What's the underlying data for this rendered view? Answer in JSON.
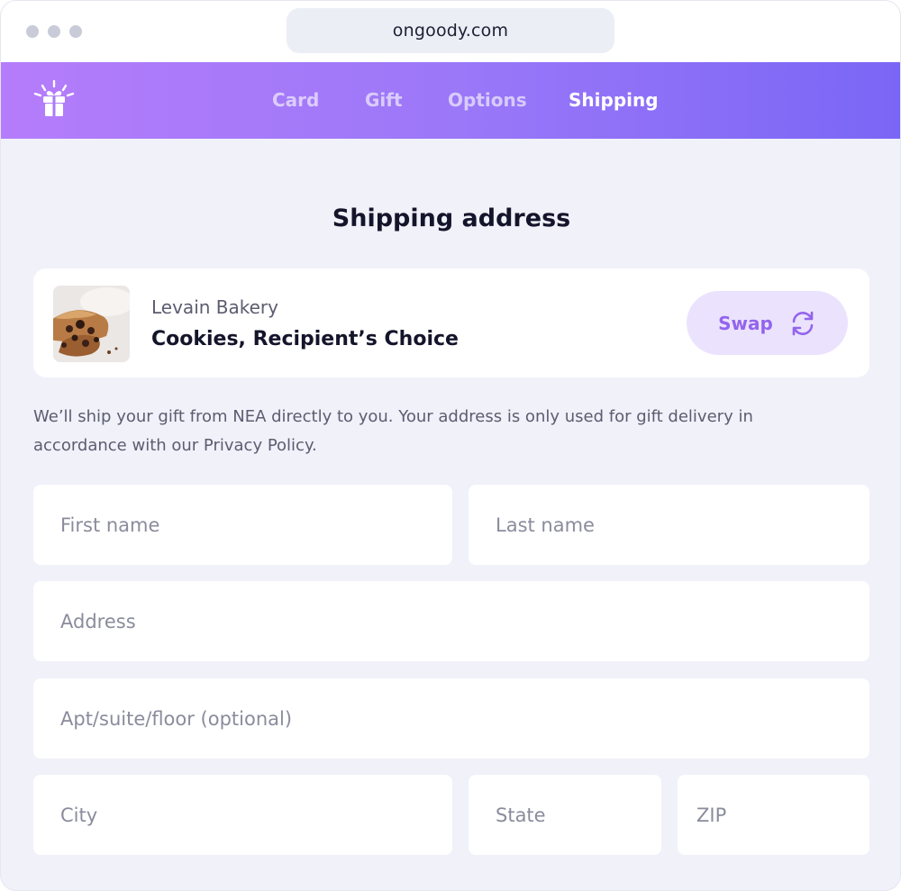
{
  "browser": {
    "url": "ongoody.com"
  },
  "nav": {
    "logo": "gift-logo-icon",
    "tabs": [
      {
        "label": "Card",
        "active": false
      },
      {
        "label": "Gift",
        "active": false
      },
      {
        "label": "Options",
        "active": false
      },
      {
        "label": "Shipping",
        "active": true
      }
    ],
    "gradient_start": "#b57cfb",
    "gradient_end": "#7a66f6"
  },
  "page": {
    "title": "Shipping address"
  },
  "product": {
    "vendor": "Levain Bakery",
    "name": "Cookies, Recipient’s Choice",
    "image": "cookies-photo",
    "swap_label": "Swap",
    "swap_icon": "refresh-icon",
    "accent": "#9364ee"
  },
  "disclaimer": "We’ll ship your gift from NEA directly to you. Your address is only used for gift delivery in accordance with our Privacy Policy.",
  "form": {
    "first_name": {
      "placeholder": "First name",
      "value": ""
    },
    "last_name": {
      "placeholder": "Last name",
      "value": ""
    },
    "address": {
      "placeholder": "Address",
      "value": ""
    },
    "apt": {
      "placeholder": "Apt/suite/floor (optional)",
      "value": ""
    },
    "city": {
      "placeholder": "City",
      "value": ""
    },
    "state": {
      "placeholder": "State",
      "value": ""
    },
    "zip": {
      "placeholder": "ZIP",
      "value": ""
    }
  }
}
